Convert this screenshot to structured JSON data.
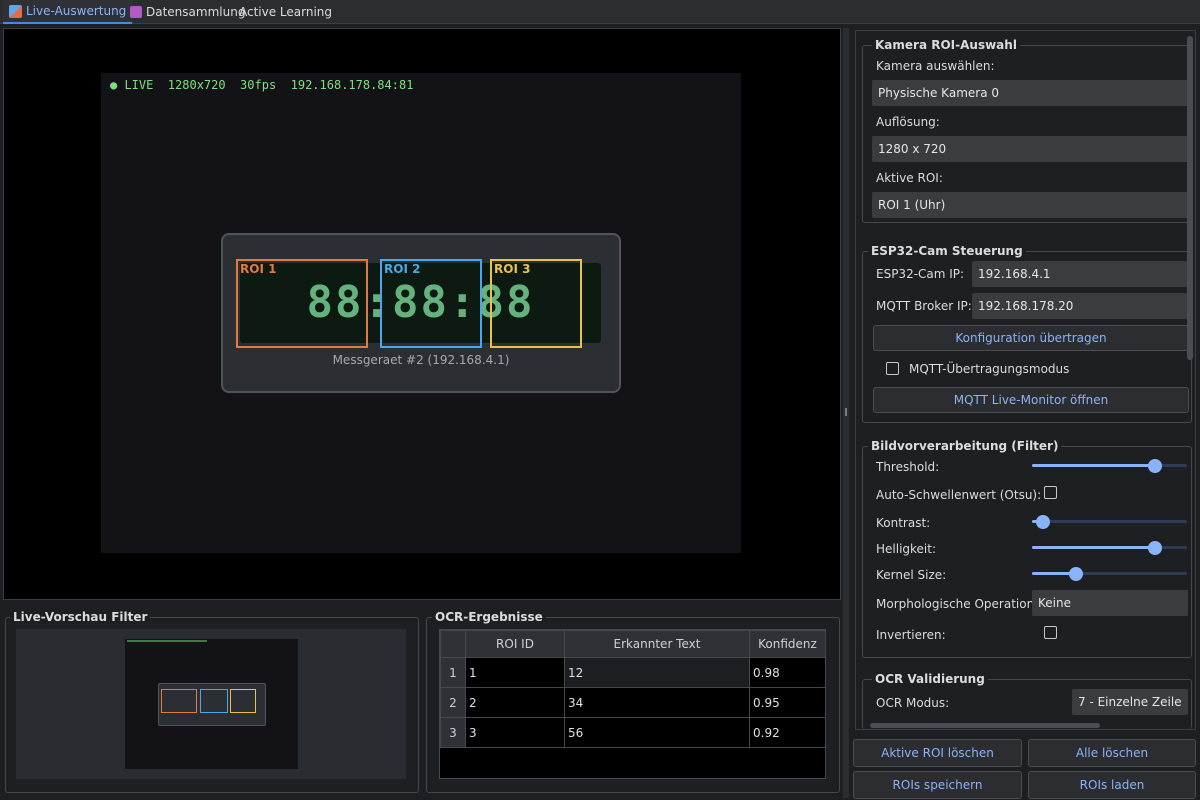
{
  "tabs": [
    {
      "label": "Live-Auswertung",
      "icon": "chart-icon",
      "active": true
    },
    {
      "label": "Datensammlung",
      "icon": "floppy-disk-icon",
      "active": false
    },
    {
      "label": "Active Learning",
      "icon": "",
      "active": false
    }
  ],
  "camera": {
    "overlay_text": "● LIVE  1280x720  30fps  192.168.178.84:81",
    "display_digits": "88:88:88",
    "device_label": "Messgeraet #2 (192.168.4.1)",
    "rois": [
      {
        "label": "ROI 1",
        "color": "#e07a3e"
      },
      {
        "label": "ROI 2",
        "color": "#4aa8e8"
      },
      {
        "label": "ROI 3",
        "color": "#e8c24a"
      }
    ]
  },
  "preview": {
    "title": "Live-Vorschau Filter"
  },
  "ocr": {
    "title": "OCR-Ergebnisse",
    "columns": [
      "ROI ID",
      "Erkannter Text",
      "Konfidenz"
    ],
    "rows": [
      {
        "num": "1",
        "roi_id": "1",
        "text": "12",
        "confidence": "0.98"
      },
      {
        "num": "2",
        "roi_id": "2",
        "text": "34",
        "confidence": "0.95"
      },
      {
        "num": "3",
        "roi_id": "3",
        "text": "56",
        "confidence": "0.92"
      }
    ]
  },
  "kamera": {
    "title": "Kamera  ROI-Auswahl",
    "camera_label": "Kamera auswählen:",
    "camera_value": "Physische Kamera 0",
    "resolution_label": "Auflösung:",
    "resolution_value": "1280 x 720",
    "roi_label": "Aktive ROI:",
    "roi_value": "ROI 1 (Uhr)"
  },
  "esp": {
    "title": "ESP32-Cam Steuerung",
    "ip_label": "ESP32-Cam IP:",
    "ip_value": "192.168.4.1",
    "broker_label": "MQTT Broker IP:",
    "broker_value": "192.168.178.20",
    "config_button": "Konfiguration übertragen",
    "mqtt_mode_label": "MQTT-Übertragungsmodus",
    "monitor_button": "MQTT Live-Monitor öffnen"
  },
  "filter": {
    "title": "Bildvorverarbeitung (Filter)",
    "threshold_label": "Threshold:",
    "threshold_level": 0.82,
    "auto_threshold_label": "Auto-Schwellenwert (Otsu):",
    "contrast_label": "Kontrast:",
    "contrast_level": 0.03,
    "brightness_label": "Helligkeit:",
    "brightness_level": 0.82,
    "kernel_label": "Kernel Size:",
    "kernel_level": 0.26,
    "morph_label": "Morphologische Operation:",
    "morph_value": "Keine",
    "invert_label": "Invertieren:"
  },
  "ocr_validation": {
    "title": "OCR  Validierung",
    "mode_label": "OCR Modus:",
    "mode_value": "7 - Einzelne Zeile"
  },
  "buttons": {
    "delete_active": "Aktive ROI löschen",
    "delete_all": "Alle löschen",
    "save_rois": "ROIs speichern",
    "load_rois": "ROIs laden"
  },
  "colors": {
    "accent": "#8ab4f8",
    "background": "#1e1f22",
    "lcd_green": "#6fc38a"
  }
}
